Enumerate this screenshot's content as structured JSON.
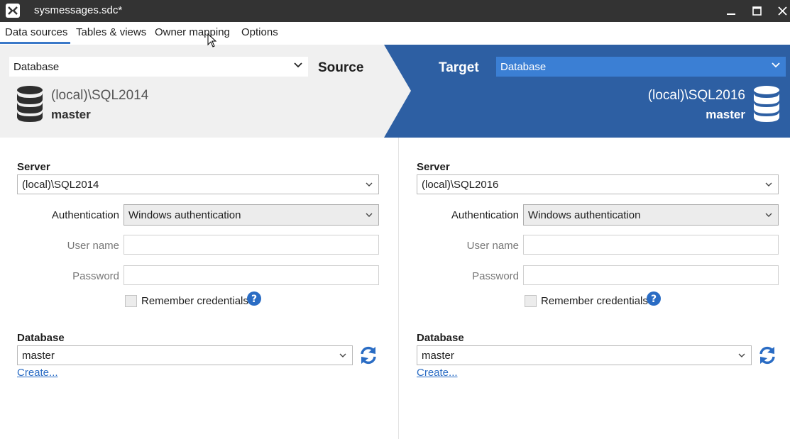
{
  "window": {
    "title": "sysmessages.sdc*"
  },
  "tabs": [
    {
      "label": "Data sources",
      "active": true
    },
    {
      "label": "Tables & views",
      "active": false
    },
    {
      "label": "Owner mapping",
      "active": false
    },
    {
      "label": "Options",
      "active": false
    }
  ],
  "banner": {
    "source": {
      "type_value": "Database",
      "label": "Source",
      "server": "(local)\\SQL2014",
      "database": "master"
    },
    "target": {
      "type_value": "Database",
      "label": "Target",
      "server": "(local)\\SQL2016",
      "database": "master"
    }
  },
  "source_form": {
    "server_label": "Server",
    "server_value": "(local)\\SQL2014",
    "auth_label": "Authentication",
    "auth_value": "Windows authentication",
    "username_label": "User name",
    "password_label": "Password",
    "remember_label": "Remember credentials",
    "remember_checked": false,
    "database_label": "Database",
    "database_value": "master",
    "create_link": "Create..."
  },
  "target_form": {
    "server_label": "Server",
    "server_value": "(local)\\SQL2016",
    "auth_label": "Authentication",
    "auth_value": "Windows authentication",
    "username_label": "User name",
    "password_label": "Password",
    "remember_label": "Remember credentials",
    "remember_checked": false,
    "database_label": "Database",
    "database_value": "master",
    "create_link": "Create..."
  },
  "colors": {
    "titlebar": "#333333",
    "target_banner": "#2d5fa3",
    "target_combo": "#3b7fd4",
    "accent": "#3a78c8",
    "link": "#2a6cc4"
  },
  "icons": {
    "app": "app-logo-icon",
    "database": "database-icon",
    "help": "help-icon",
    "refresh": "refresh-icon",
    "dropdown": "chevron-down-icon"
  }
}
